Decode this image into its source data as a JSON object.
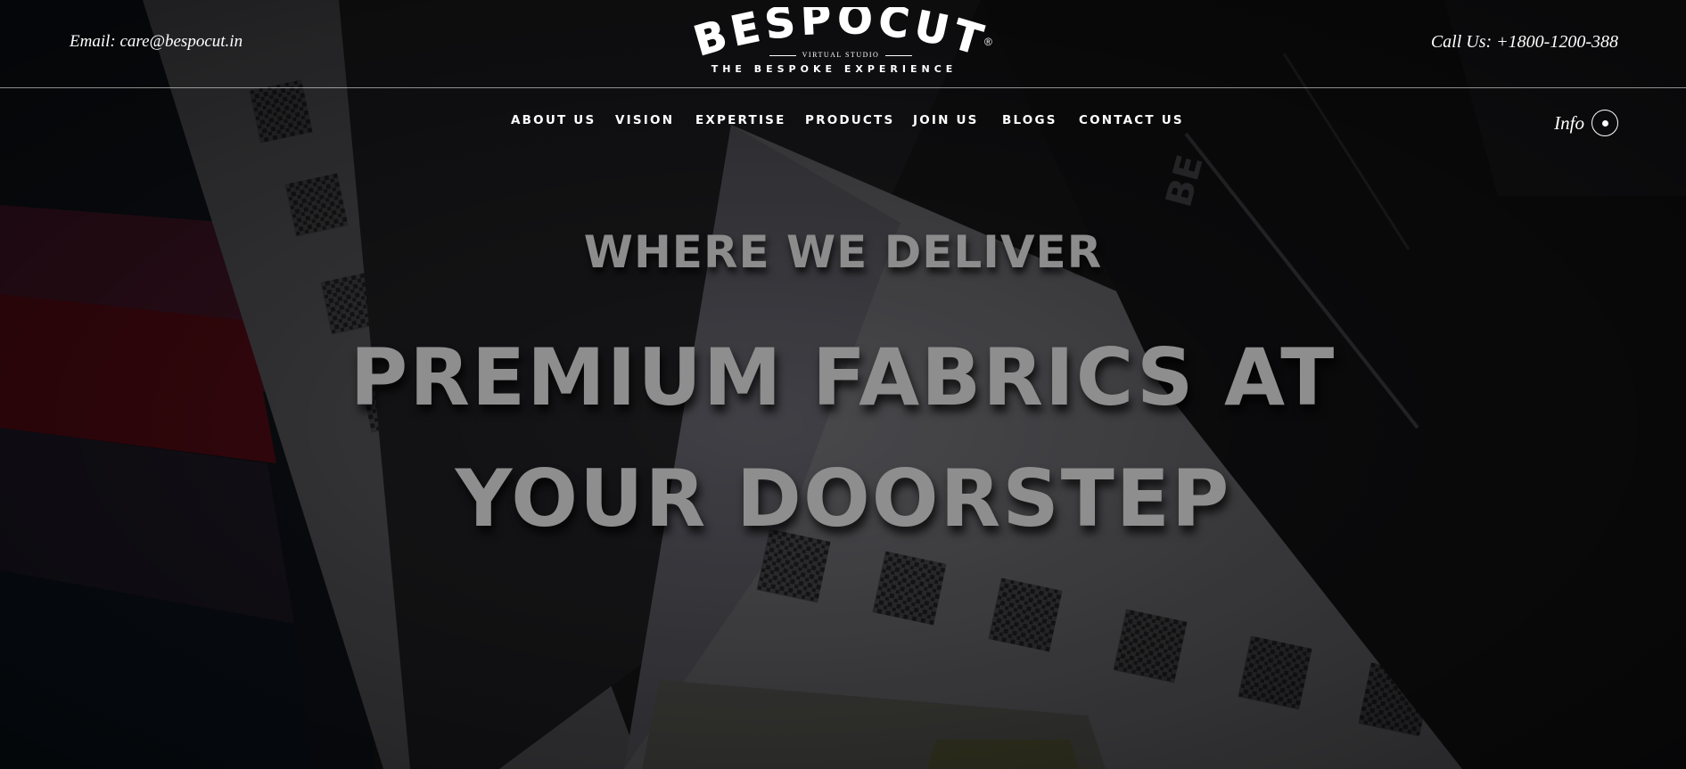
{
  "header": {
    "email": "Email: care@bespocut.in",
    "phone": "Call Us: +1800-1200-388"
  },
  "logo": {
    "wordmark": "BESPOCUT",
    "registered": "®",
    "studio": "VIRTUAL STUDIO",
    "tagline": "THE BESPOKE EXPERIENCE"
  },
  "nav": {
    "items": [
      {
        "label": "ABOUT US"
      },
      {
        "label": "VISION"
      },
      {
        "label": "EXPERTISE"
      },
      {
        "label": "PRODUCTS"
      },
      {
        "label": "JOIN US"
      },
      {
        "label": "BLOGS"
      },
      {
        "label": "CONTACT US"
      }
    ]
  },
  "info": {
    "label": "Info"
  },
  "hero": {
    "eyebrow": "WHERE WE DELIVER",
    "headline_line1": "PREMIUM FABRICS AT",
    "headline_line2": "YOUR DOORSTEP",
    "swatch_brand": "BE"
  },
  "icons": {
    "info_button": "dot-circle-icon",
    "background": "fabric-swatches-image"
  }
}
